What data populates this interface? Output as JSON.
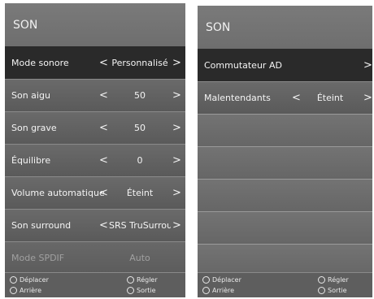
{
  "left_panel": {
    "title": "SON",
    "rows": [
      {
        "label": "Mode sonore",
        "value": "Personnalisé",
        "left_arrow": "<",
        "right_arrow": ">"
      },
      {
        "label": "Son aigu",
        "value": "50",
        "left_arrow": "<",
        "right_arrow": ">"
      },
      {
        "label": "Son grave",
        "value": "50",
        "left_arrow": "<",
        "right_arrow": ">"
      },
      {
        "label": "Équilibre",
        "value": "0",
        "left_arrow": "<",
        "right_arrow": ">"
      },
      {
        "label": "Volume automatique",
        "value": "Éteint",
        "left_arrow": "<",
        "right_arrow": ">"
      },
      {
        "label": "Son surround",
        "value": "SRS TruSurrou..",
        "left_arrow": "<",
        "right_arrow": ">"
      },
      {
        "label": "Mode SPDIF",
        "value": "Auto"
      }
    ],
    "footer": {
      "move": "Déplacer",
      "adjust": "Régler",
      "back": "Arrière",
      "exit": "Sortie"
    }
  },
  "right_panel": {
    "title": "SON",
    "rows": [
      {
        "label": "Commutateur AD",
        "right_arrow": ">"
      },
      {
        "label": "Malentendants",
        "value": "Éteint",
        "left_arrow": "<",
        "right_arrow": ">"
      }
    ],
    "footer": {
      "move": "Déplacer",
      "adjust": "Régler",
      "back": "Arrière",
      "exit": "Sortie"
    }
  }
}
